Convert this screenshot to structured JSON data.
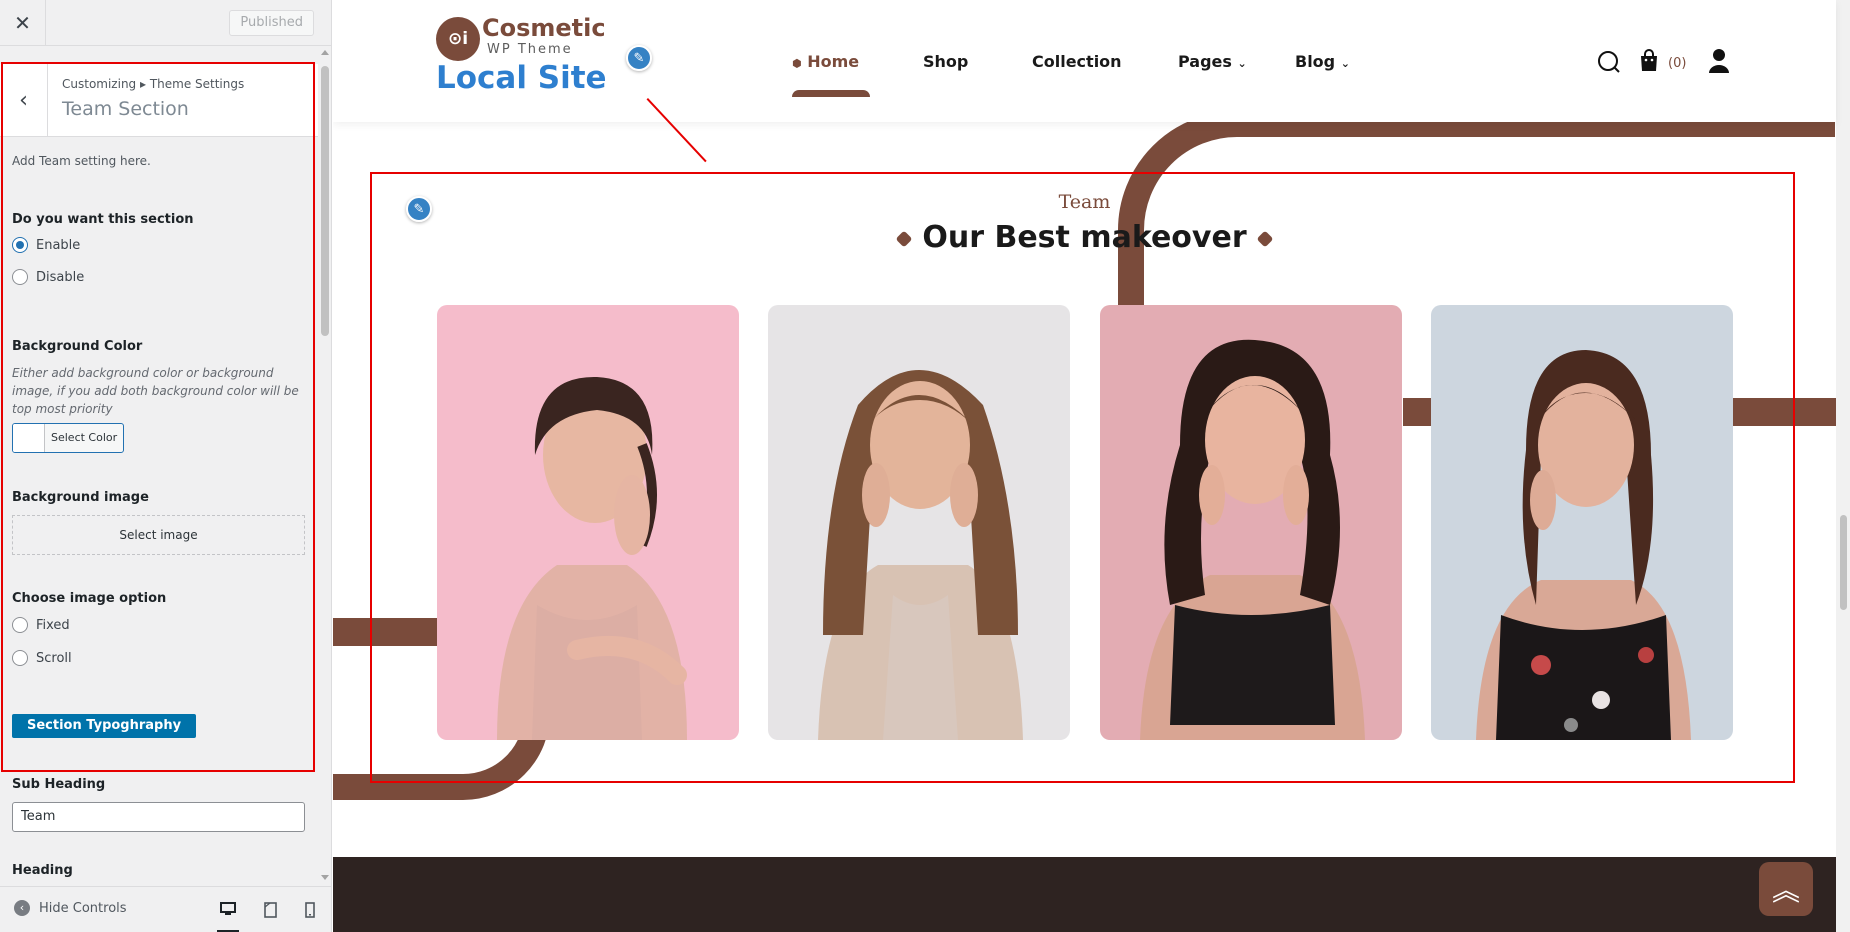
{
  "customizer": {
    "published_label": "Published",
    "breadcrumb": "Customizing ▸ Theme Settings",
    "section_title": "Team Section",
    "description": "Add Team setting here.",
    "section_toggle": {
      "label": "Do you want this section",
      "options": [
        "Enable",
        "Disable"
      ],
      "selected": "Enable"
    },
    "background_color": {
      "label": "Background Color",
      "help": "Either add background color or background image, if you add both background color will be top most priority",
      "button_label": "Select Color"
    },
    "background_image": {
      "label": "Background image",
      "button_label": "Select image"
    },
    "image_option": {
      "label": "Choose image option",
      "options": [
        "Fixed",
        "Scroll"
      ]
    },
    "typography_button": "Section Typoghraphy",
    "sub_heading": {
      "label": "Sub Heading",
      "value": "Team"
    },
    "heading_label": "Heading",
    "footer": {
      "hide_controls": "Hide Controls",
      "devices": [
        "desktop-icon",
        "tablet-icon",
        "mobile-icon"
      ]
    }
  },
  "site": {
    "logo": {
      "name": "Cosmetic",
      "tagline": "WP Theme",
      "title": "Local Site"
    },
    "nav": [
      {
        "label": "Home",
        "active": true
      },
      {
        "label": "Shop"
      },
      {
        "label": "Collection"
      },
      {
        "label": "Pages",
        "dropdown": true
      },
      {
        "label": "Blog",
        "dropdown": true
      }
    ],
    "cart_count": "(0)",
    "team": {
      "sub_heading": "Team",
      "heading": "Our Best makeover",
      "members": [
        {
          "background": "#f5bccb",
          "top": "#efb7c4"
        },
        {
          "background": "#e6e4e6",
          "top": "#dfdde0"
        },
        {
          "background": "#e3acb3",
          "top": "#dba3ab"
        },
        {
          "background": "#cdd6df",
          "top": "#c6cfd9"
        }
      ]
    }
  },
  "colors": {
    "brand": "#7a4b3b",
    "accent_blue": "#2e7fcf",
    "wp_blue": "#0073aa",
    "highlight": "#e60000"
  }
}
